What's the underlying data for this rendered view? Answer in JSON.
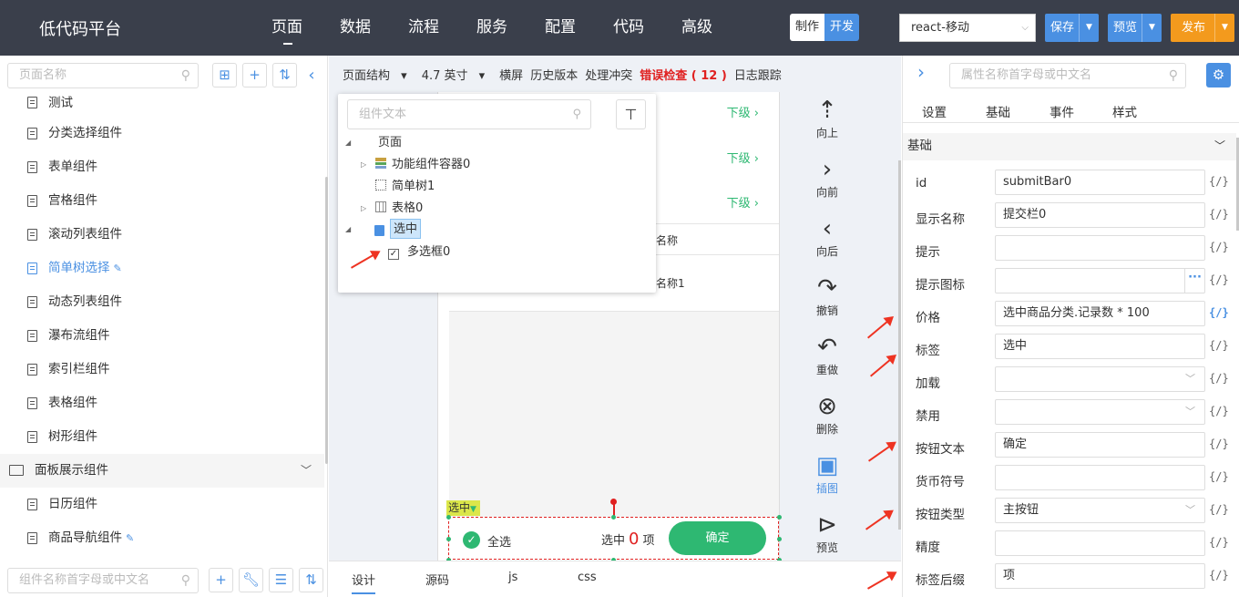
{
  "header": {
    "brand": "低代码平台",
    "nav": [
      "页面",
      "数据",
      "流程",
      "服务",
      "配置",
      "代码",
      "高级"
    ],
    "mode": {
      "make": "制作",
      "dev": "开发"
    },
    "target_select": "react-移动",
    "save": "保存",
    "preview": "预览",
    "publish": "发布"
  },
  "left": {
    "search_placeholder": "页面名称",
    "items": [
      {
        "label": "测试"
      },
      {
        "label": "分类选择组件"
      },
      {
        "label": "表单组件"
      },
      {
        "label": "宫格组件"
      },
      {
        "label": "滚动列表组件"
      },
      {
        "label": "简单树选择"
      },
      {
        "label": "动态列表组件"
      },
      {
        "label": "瀑布流组件"
      },
      {
        "label": "索引栏组件"
      },
      {
        "label": "表格组件"
      },
      {
        "label": "树形组件"
      },
      {
        "label": "面板展示组件"
      },
      {
        "label": "日历组件"
      },
      {
        "label": "商品导航组件"
      }
    ],
    "component_search_placeholder": "组件名称首字母或中文名"
  },
  "canvas": {
    "toolbar": {
      "structure": "页面结构",
      "size": "4.7 英寸",
      "landscape": "横屏",
      "history": "历史版本",
      "conflict": "处理冲突",
      "error_check": "错误检查 ( 12 )",
      "log": "日志跟踪"
    },
    "rows_next": [
      "下级",
      "下级",
      "下级"
    ],
    "table_header_name": "名称",
    "table_cell": "名称1",
    "popup": {
      "search_placeholder": "组件文本",
      "nodes": {
        "page": "页面",
        "container": "功能组件容器0",
        "tree": "简单树1",
        "table": "表格0",
        "selected": "选中",
        "checkbox": "多选框0"
      }
    },
    "selected_tag": "选中",
    "submit_bar": {
      "select_all": "全选",
      "count_prefix": "选中",
      "count": "0",
      "count_suffix": "项",
      "confirm": "确定"
    },
    "controls": {
      "up": "向上",
      "forward": "向前",
      "back": "向后",
      "undo": "撤销",
      "redo": "重做",
      "delete": "删除",
      "image": "插图",
      "preview": "预览"
    },
    "bottom_tabs": [
      "设计",
      "源码",
      "js",
      "css"
    ]
  },
  "right": {
    "search_placeholder": "属性名称首字母或中文名",
    "tabs": [
      "设置",
      "基础",
      "事件",
      "样式"
    ],
    "section": "基础",
    "props": [
      {
        "label": "id",
        "value": ""
      },
      {
        "label": "显示名称",
        "value": ""
      },
      {
        "label": "提示",
        "value": ""
      },
      {
        "label": "提示图标",
        "value": ""
      },
      {
        "label": "价格",
        "value": ""
      },
      {
        "label": "标签",
        "value": ""
      },
      {
        "label": "加载",
        "value": ""
      },
      {
        "label": "禁用",
        "value": ""
      },
      {
        "label": "按钮文本",
        "value": ""
      },
      {
        "label": "货币符号",
        "value": ""
      },
      {
        "label": "按钮类型",
        "value": ""
      },
      {
        "label": "精度",
        "value": ""
      },
      {
        "label": "标签后缀",
        "value": ""
      }
    ],
    "values": {
      "id": "submitBar0",
      "display_name": "提交栏0",
      "price": "选中商品分类.记录数 * 100",
      "tag": "选中",
      "button_text": "确定",
      "button_type": "主按钮",
      "tag_suffix": "项"
    },
    "fx": "{/}"
  },
  "colors": {
    "topbar": "#3a3f4b",
    "accent": "#4a90e2",
    "publish": "#f39a1d",
    "green": "#2eb872",
    "error": "#e02020"
  }
}
